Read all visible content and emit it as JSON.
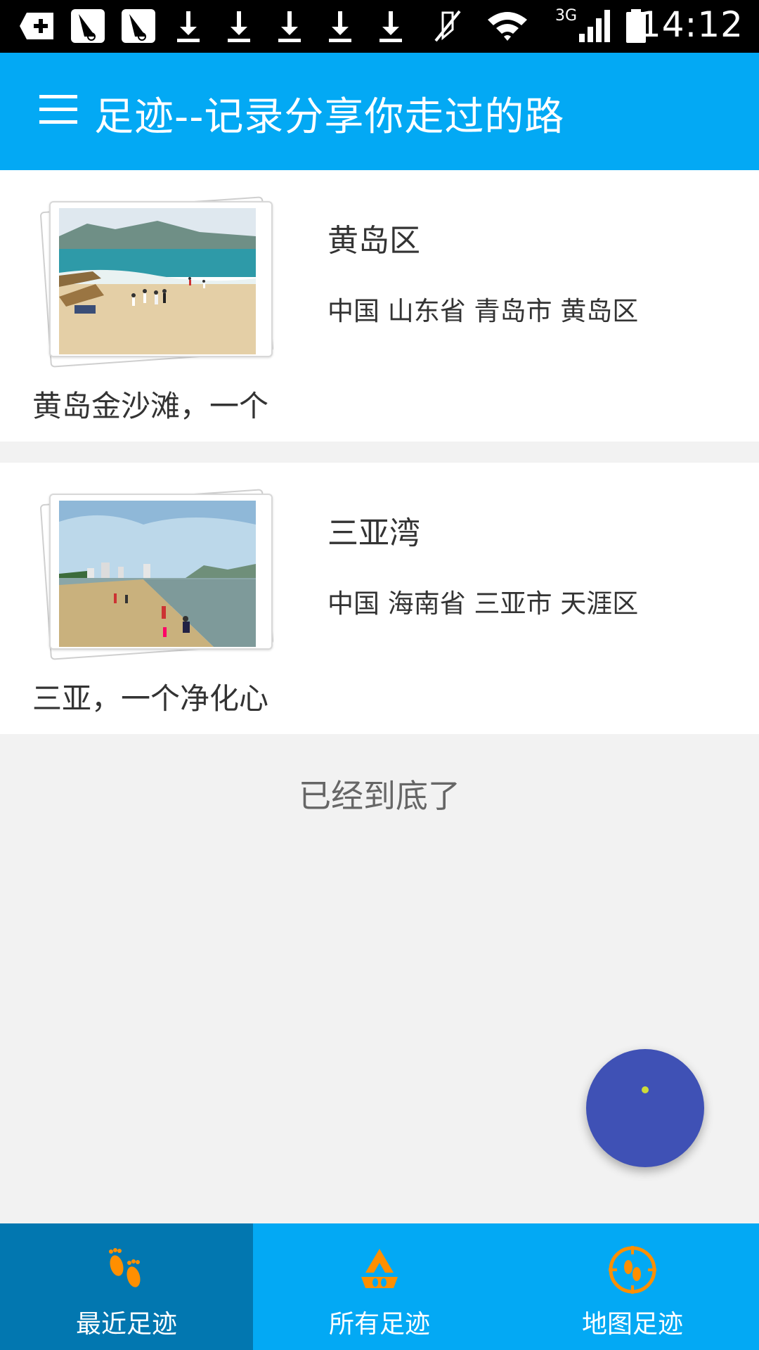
{
  "status_bar": {
    "time": "14:12",
    "network": "3G",
    "icons": [
      "add-notification-icon",
      "windsurf-app-icon",
      "windsurf-app-icon",
      "download-icon",
      "download-icon",
      "download-icon",
      "download-icon",
      "download-icon",
      "mute-icon",
      "wifi-icon",
      "signal-icon",
      "battery-icon"
    ]
  },
  "app_bar": {
    "title": "足迹--记录分享你走过的路",
    "menu_icon": "menu-icon"
  },
  "cards": [
    {
      "title": "黄岛区",
      "address": "中国 山东省 青岛市 黄岛区",
      "description": "黄岛金沙滩，一个"
    },
    {
      "title": "三亚湾",
      "address": "中国 海南省 三亚市 天涯区",
      "description": "三亚，一个净化心"
    }
  ],
  "end_text": "已经到底了",
  "bottom_nav": {
    "items": [
      {
        "label": "最近足迹",
        "icon": "footprints-icon",
        "active": true
      },
      {
        "label": "所有足迹",
        "icon": "footprints-recycle-icon",
        "active": false
      },
      {
        "label": "地图足迹",
        "icon": "footprints-compass-icon",
        "active": false
      }
    ]
  },
  "colors": {
    "primary": "#03a9f4",
    "primary_dark": "#0277b0",
    "fab": "#3f51b5",
    "nav_icon": "#ff8f00"
  }
}
